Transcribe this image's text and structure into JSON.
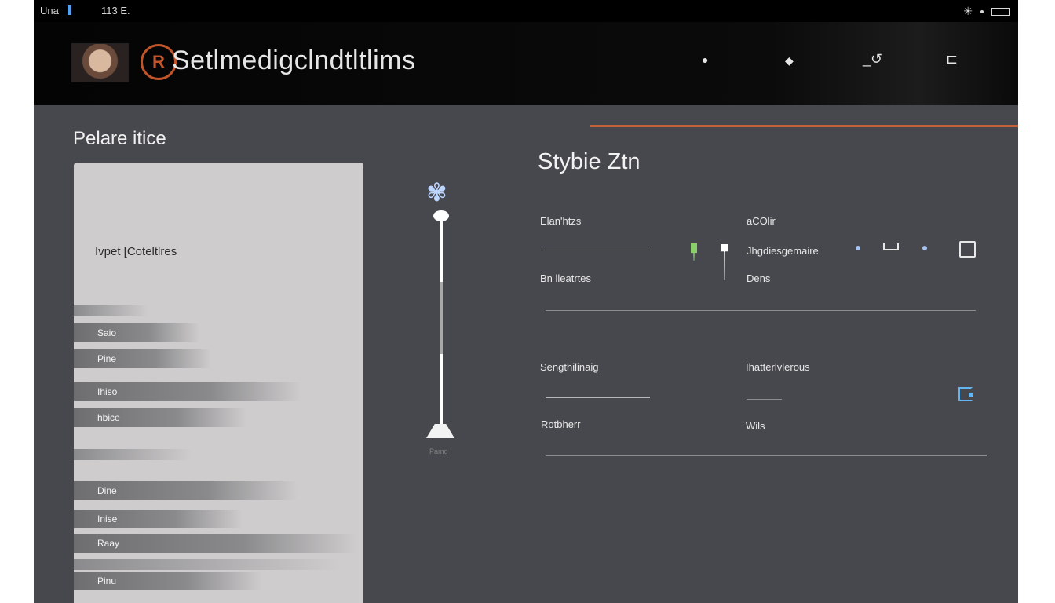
{
  "status_bar": {
    "carrier": "Una",
    "time": "113 E."
  },
  "header": {
    "logo_glyph": "R",
    "app_title": "Setlmedigclndtltlims",
    "icons": [
      "dot-icon",
      "diamond-icon",
      "refresh-icon",
      "message-icon"
    ]
  },
  "left": {
    "section_title": "Pelare itice",
    "panel_label": "Ivpet [Coteltlres",
    "items": [
      "Saio",
      "Pine",
      "Ihiso",
      "hbice",
      "Dine",
      "Inise",
      "Raay",
      "Pinu"
    ]
  },
  "slider": {
    "caption": "Pamo"
  },
  "settings": {
    "title": "Stybie Ztn",
    "row1": {
      "left_label": "Elan'htzs",
      "left_sublabel": "Bn lleatrtes",
      "right_label": "aCOlir",
      "right_value": "Jhgdiesgemaire",
      "right_sublabel": "Dens"
    },
    "row2": {
      "left_label": "Sengthilinaig",
      "left_sublabel": "Rotbherr",
      "right_label": "Ihatterlvlerous",
      "right_sublabel": "Wils"
    }
  },
  "colors": {
    "accent": "#c3623a",
    "background": "#46484d",
    "header": "#000000",
    "panel": "#cfcccd",
    "link_blue": "#64b4f0"
  }
}
